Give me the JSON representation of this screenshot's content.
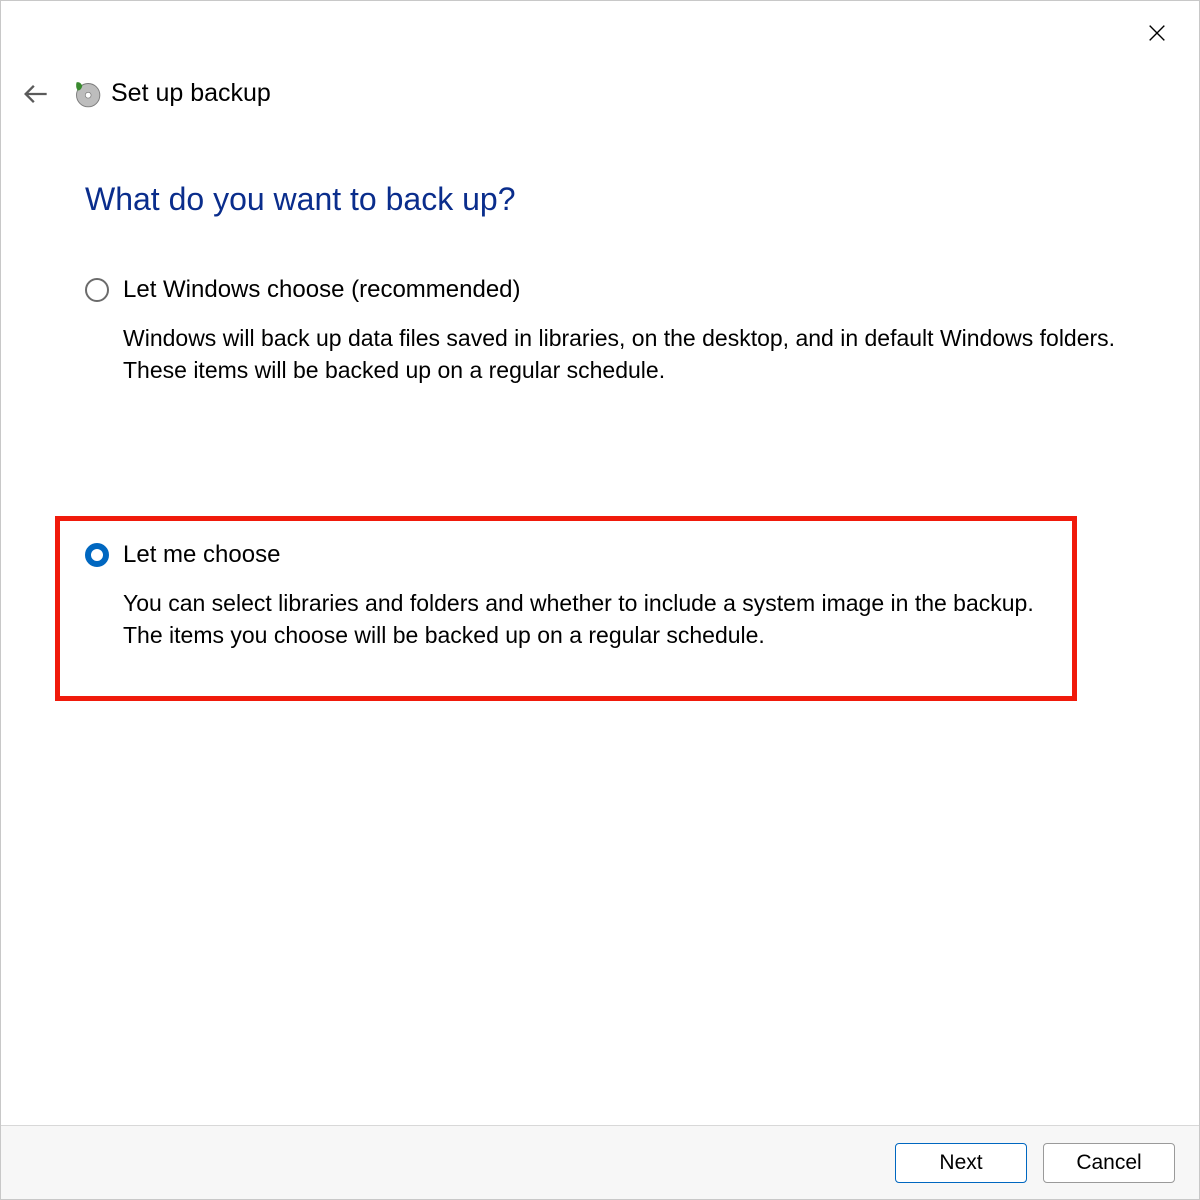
{
  "window": {
    "title": "Set up backup"
  },
  "heading": "What do you want to back up?",
  "options": [
    {
      "label": "Let Windows choose (recommended)",
      "description": "Windows will back up data files saved in libraries, on the desktop, and in default Windows folders. These items will be backed up on a regular schedule.",
      "selected": false
    },
    {
      "label": "Let me choose",
      "description": "You can select libraries and folders and whether to include a system image in the backup. The items you choose will be backed up on a regular schedule.",
      "selected": true
    }
  ],
  "buttons": {
    "next": "Next",
    "cancel": "Cancel"
  }
}
